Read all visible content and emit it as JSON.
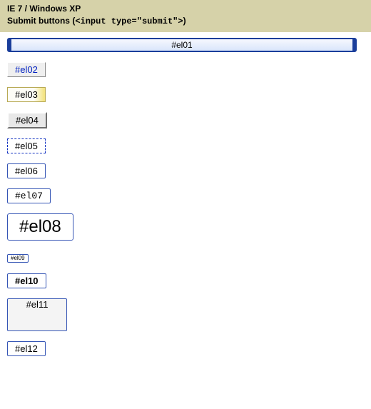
{
  "header": {
    "line1": "IE 7 / Windows XP",
    "line2_prefix": "Submit buttons (",
    "line2_code": "<input type=\"submit\">",
    "line2_suffix": ")"
  },
  "buttons": {
    "el01": "#el01",
    "el02": "#el02",
    "el03": "#el03",
    "el04": "#el04",
    "el05": "#el05",
    "el06": "#el06",
    "el07": "#el07",
    "el08": "#el08",
    "el09": "#el09",
    "el10": "#el10",
    "el11": "#el11",
    "el12": "#el12"
  }
}
